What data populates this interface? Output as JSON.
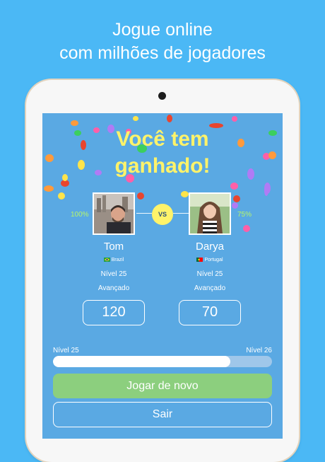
{
  "promo": {
    "headline_line1": "Jogue online",
    "headline_line2": "com milhões de jogadores"
  },
  "result": {
    "title_line1": "Você tem",
    "title_line2": "ganhado!",
    "vs_label": "VS"
  },
  "players": [
    {
      "name": "Tom",
      "country": "Brazil",
      "flag_icon": "brazil-flag-icon",
      "level": "Nível 25",
      "rank": "Avançado",
      "score": "120",
      "percent": "100%"
    },
    {
      "name": "Darya",
      "country": "Portugal",
      "flag_icon": "portugal-flag-icon",
      "level": "Nível 25",
      "rank": "Avançado",
      "score": "70",
      "percent": "75%"
    }
  ],
  "progress": {
    "current_level": "Nível 25",
    "next_level": "Nível 26",
    "fraction": 0.81
  },
  "buttons": {
    "play_again": "Jogar de novo",
    "exit": "Sair"
  },
  "colors": {
    "background": "#4bb8f5",
    "screen": "#5aa9e3",
    "title_yellow": "#fff36a",
    "play_again_green": "#8ccf7e",
    "percent_green": "#b7f56a"
  }
}
